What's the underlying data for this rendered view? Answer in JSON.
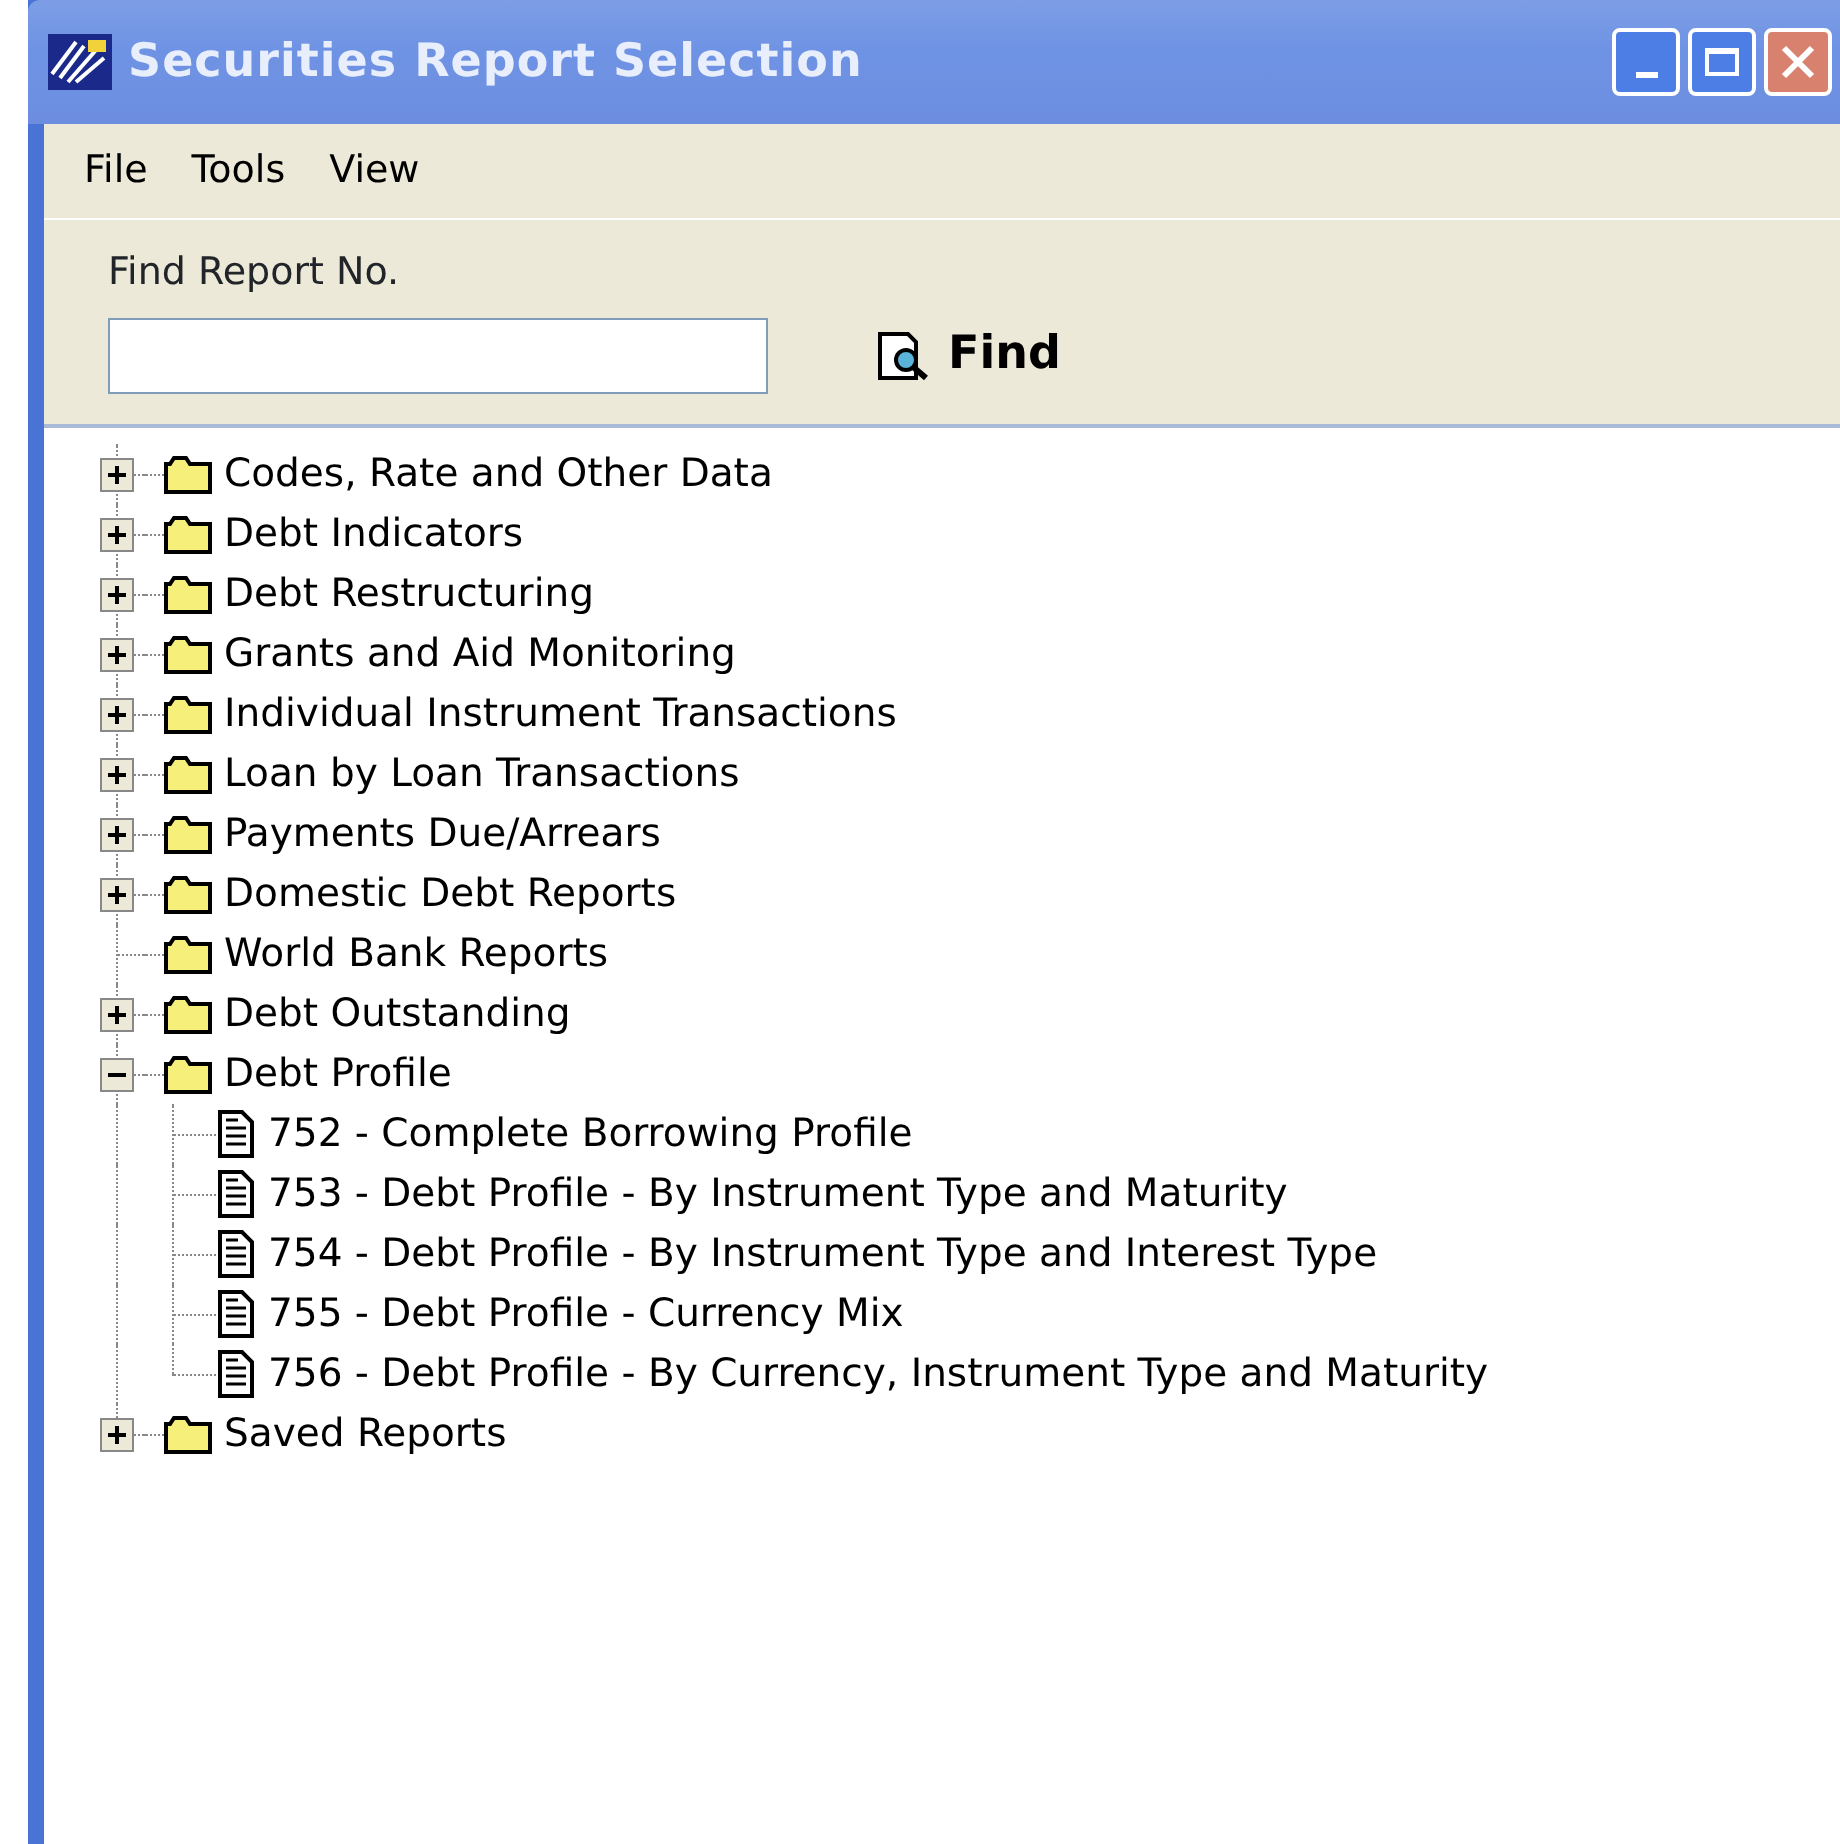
{
  "window": {
    "title": "Securities Report Selection"
  },
  "menu": [
    "File",
    "Tools",
    "View"
  ],
  "find": {
    "label": "Find Report No.",
    "button": "Find"
  },
  "tree": [
    {
      "kind": "folder",
      "label": "Codes, Rate and Other Data",
      "expanded": false
    },
    {
      "kind": "folder",
      "label": "Debt Indicators",
      "expanded": false
    },
    {
      "kind": "folder",
      "label": "Debt Restructuring",
      "expanded": false
    },
    {
      "kind": "folder",
      "label": "Grants and Aid Monitoring",
      "expanded": false
    },
    {
      "kind": "folder",
      "label": "Individual Instrument Transactions",
      "expanded": false
    },
    {
      "kind": "folder",
      "label": "Loan by Loan Transactions",
      "expanded": false
    },
    {
      "kind": "folder",
      "label": "Payments Due/Arrears",
      "expanded": false
    },
    {
      "kind": "folder",
      "label": "Domestic Debt Reports",
      "expanded": false
    },
    {
      "kind": "folder",
      "label": "World Bank Reports"
    },
    {
      "kind": "folder",
      "label": "Debt Outstanding",
      "expanded": false
    },
    {
      "kind": "folder",
      "label": "Debt Profile",
      "expanded": true,
      "children": [
        {
          "kind": "report",
          "label": "752 - Complete Borrowing Profile"
        },
        {
          "kind": "report",
          "label": "753 - Debt Profile - By Instrument Type and Maturity"
        },
        {
          "kind": "report",
          "label": "754 - Debt Profile - By Instrument Type and Interest Type"
        },
        {
          "kind": "report",
          "label": "755 - Debt Profile - Currency Mix"
        },
        {
          "kind": "report",
          "label": "756 - Debt Profile - By Currency, Instrument Type and Maturity"
        }
      ]
    },
    {
      "kind": "folder",
      "label": "Saved Reports",
      "expanded": false
    }
  ]
}
